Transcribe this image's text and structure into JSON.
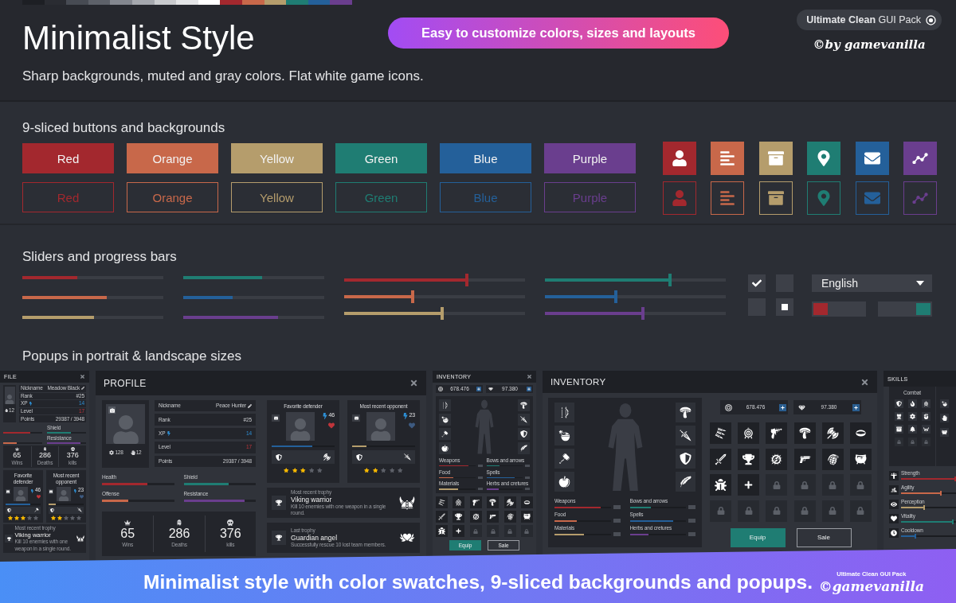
{
  "palette": [
    {
      "color": "#1d1f24"
    },
    {
      "color": "#2a2c32"
    },
    {
      "color": "#474b53"
    },
    {
      "color": "#5d6169"
    },
    {
      "color": "#83878f"
    },
    {
      "color": "#a5a8ae"
    },
    {
      "color": "#c9cbce"
    },
    {
      "color": "#e4e5e7"
    },
    {
      "color": "#ffffff"
    },
    {
      "color": "#a3282e"
    },
    {
      "color": "#c8684a"
    },
    {
      "color": "#b59d6c"
    },
    {
      "color": "#1f7d73"
    },
    {
      "color": "#24609a"
    },
    {
      "color": "#6a3e8e"
    }
  ],
  "header": {
    "title": "Minimalist Style",
    "tagline": "Easy to customize colors, sizes and layouts",
    "pack_badge": "**Ultimate Clean** GUI Pack",
    "credit": "©by game**vanilla**",
    "subtitle": "Sharp backgrounds, muted and gray colors. Flat white game icons."
  },
  "buttons_section": {
    "heading": "9-sliced buttons and backgrounds",
    "filled_buttons": [
      {
        "label": "Red",
        "color": "#a3282e"
      },
      {
        "label": "Orange",
        "color": "#c8684a"
      },
      {
        "label": "Yellow",
        "color": "#b59d6c"
      },
      {
        "label": "Green",
        "color": "#1f7d73"
      },
      {
        "label": "Blue",
        "color": "#24609a"
      },
      {
        "label": "Purple",
        "color": "#6a3e8e"
      }
    ],
    "outline_buttons": [
      {
        "label": "Red",
        "color": "#a3282e"
      },
      {
        "label": "Orange",
        "color": "#c8684a"
      },
      {
        "label": "Yellow",
        "color": "#b59d6c"
      },
      {
        "label": "Green",
        "color": "#1f7d73"
      },
      {
        "label": "Blue",
        "color": "#24609a"
      },
      {
        "label": "Purple",
        "color": "#6a3e8e"
      }
    ],
    "filled_tiles": [
      {
        "kind": "person",
        "color": "#a3282e"
      },
      {
        "kind": "bars",
        "color": "#c8684a"
      },
      {
        "kind": "box",
        "color": "#b59d6c"
      },
      {
        "kind": "pin",
        "color": "#1f7d73"
      },
      {
        "kind": "mail",
        "color": "#24609a"
      },
      {
        "kind": "chart",
        "color": "#6a3e8e"
      }
    ],
    "outline_tiles": [
      {
        "kind": "person",
        "color": "#a3282e"
      },
      {
        "kind": "bars",
        "color": "#c8684a"
      },
      {
        "kind": "box",
        "color": "#b59d6c"
      },
      {
        "kind": "pin",
        "color": "#1f7d73"
      },
      {
        "kind": "mail",
        "color": "#24609a"
      },
      {
        "kind": "chart",
        "color": "#6a3e8e"
      }
    ]
  },
  "sliders_section": {
    "heading": "Sliders and progress bars",
    "progress_columns": [
      {
        "bars": [
          {
            "color": "#a3282e",
            "level": 0.39
          },
          {
            "color": "#c8684a",
            "level": 0.6
          },
          {
            "color": "#b59d6c",
            "level": 0.51
          }
        ]
      },
      {
        "bars": [
          {
            "color": "#1f7d73",
            "level": 0.56
          },
          {
            "color": "#24609a",
            "level": 0.35
          },
          {
            "color": "#6a3e8e",
            "level": 0.67
          }
        ]
      }
    ],
    "slider_columns": [
      {
        "sliders": [
          {
            "color": "#a3282e",
            "level": 0.68
          },
          {
            "color": "#c8684a",
            "level": 0.38
          },
          {
            "color": "#b59d6c",
            "level": 0.54
          }
        ]
      },
      {
        "sliders": [
          {
            "color": "#1f7d73",
            "level": 0.69
          },
          {
            "color": "#24609a",
            "level": 0.39
          },
          {
            "color": "#6a3e8e",
            "level": 0.54
          }
        ]
      }
    ],
    "tick_checkboxes": [
      {
        "checked": true
      },
      {
        "checked": false
      }
    ],
    "square_checkboxes": [
      {
        "checked": false
      },
      {
        "checked": true
      }
    ],
    "dropdown": {
      "value": "English"
    },
    "toggles": [
      {
        "on": false
      },
      {
        "on": true
      }
    ]
  },
  "popups_section": {
    "heading": "Popups in portrait & landscape sizes",
    "profile_portrait": {
      "title": "FILE",
      "avatar_stats": [
        {
          "kind": "hand",
          "value": "12"
        }
      ],
      "fields": [
        {
          "kind": "edit",
          "label": "Nickname",
          "value": "Meadow Black"
        },
        {
          "kind": "plain",
          "label": "Rank",
          "value": "#25"
        },
        {
          "kind": "xp",
          "label": "XP",
          "value": "14"
        },
        {
          "kind": "level",
          "label": "Level",
          "value": "17"
        },
        {
          "kind": "plain",
          "label": "Points",
          "value": "29387 / 3948"
        }
      ],
      "bars": [
        {
          "color": "#a3282e",
          "level": 0.7
        },
        {
          "label": "Shield",
          "color": "#1f7d73",
          "level": 0.62
        },
        {
          "color": "#c8684a",
          "level": 0.35
        },
        {
          "label": "Resistance",
          "color": "#6a3e8e",
          "level": 0.85
        }
      ],
      "stats": [
        {
          "kind": "crown",
          "value": "65",
          "label": "Wins"
        },
        {
          "kind": "tomb",
          "value": "286",
          "label": "Deaths"
        },
        {
          "kind": "skull",
          "value": "376",
          "label": "kills"
        }
      ],
      "cards": [
        {
          "title": "Favorite defender",
          "power": "46",
          "favorite": true,
          "color": "#24609a",
          "level": 0.7,
          "kind": "hammer",
          "stars": 3
        },
        {
          "title": "Most recent opponent",
          "power": "23",
          "favorite": false,
          "color": "#b59d6c",
          "level": 0.2,
          "kind": "dagger",
          "stars": 2
        }
      ],
      "trophies": [
        {
          "kind": "viking",
          "caption": "Most recent trophy",
          "name": "Viking warrior",
          "description": "Kill 10 enemies with one weapon in a single round."
        }
      ]
    },
    "profile_landscape": {
      "title": "PROFILE",
      "avatar_stats": [
        {
          "kind": "gear",
          "value": "128"
        },
        {
          "kind": "hand",
          "value": "12"
        }
      ],
      "fields": [
        {
          "kind": "edit",
          "label": "Nickname",
          "value": "Peace Hunter"
        },
        {
          "kind": "plain",
          "label": "Rank",
          "value": "#25"
        },
        {
          "kind": "xp",
          "label": "XP",
          "value": "14"
        },
        {
          "kind": "level",
          "label": "Level",
          "value": "17"
        },
        {
          "kind": "plain",
          "label": "Points",
          "value": "29387 / 3948"
        }
      ],
      "bars": [
        {
          "label": "Health",
          "color": "#a3282e",
          "level": 0.63
        },
        {
          "label": "Shield",
          "color": "#1f7d73",
          "level": 0.62
        },
        {
          "label": "Offense",
          "color": "#c8684a",
          "level": 0.37
        },
        {
          "label": "Resistance",
          "color": "#6a3e8e",
          "level": 0.85
        }
      ],
      "stats": [
        {
          "kind": "crown",
          "value": "65",
          "label": "Wins"
        },
        {
          "kind": "tomb",
          "value": "286",
          "label": "Deaths"
        },
        {
          "kind": "skull",
          "value": "376",
          "label": "kills"
        }
      ],
      "cards": [
        {
          "title": "Favorite defender",
          "power": "46",
          "favorite": true,
          "color": "#24609a",
          "level": 0.65,
          "kind": "axe",
          "stars": 3
        },
        {
          "title": "Most recent opponent",
          "power": "23",
          "favorite": false,
          "color": "#b59d6c",
          "level": 0.23,
          "kind": "dagger",
          "stars": 2
        }
      ],
      "trophies": [
        {
          "kind": "viking",
          "caption": "Most recent trophy",
          "name": "Viking warrior",
          "description": "Kill 10 enemies with one weapon in a single round."
        },
        {
          "kind": "angel",
          "caption": "Last trophy",
          "name": "Guardian angel",
          "description": "Successfully rescue 10 lost team members."
        }
      ]
    },
    "inventory_portrait": {
      "title": "INVENTORY",
      "currencies": [
        {
          "kind": "coin",
          "value": "678.476"
        },
        {
          "kind": "gem",
          "value": "97.380"
        }
      ],
      "left_slots": [
        {
          "kind": "bow"
        },
        {
          "kind": "potion"
        },
        {
          "kind": "hammer"
        },
        {
          "kind": "apple"
        }
      ],
      "right_slots": [
        {
          "kind": "mushroom"
        },
        {
          "kind": "dagger"
        },
        {
          "kind": "shield"
        },
        {
          "kind": "feather"
        }
      ],
      "bars": [
        {
          "label": "Weapons",
          "color": "#a3282e",
          "level": 0.82
        },
        {
          "label": "Bows and arrows",
          "color": "#1f7d73",
          "level": 0.37
        },
        {
          "label": "Food",
          "color": "#c8684a",
          "level": 0.4
        },
        {
          "label": "Spells",
          "color": "#24609a",
          "level": 0.77
        },
        {
          "label": "Materials",
          "color": "#b59d6c",
          "level": 0.52
        },
        {
          "label": "Herbs and cretures",
          "color": "#6a3e8e",
          "level": 0.33
        }
      ],
      "items": [
        {
          "kind": "bullets"
        },
        {
          "kind": "target"
        },
        {
          "kind": "raygun"
        },
        {
          "kind": "mushroom"
        },
        {
          "kind": "axe"
        },
        {
          "kind": "ring"
        },
        {
          "kind": "sword"
        },
        {
          "kind": "trophy"
        },
        {
          "kind": "compass"
        },
        {
          "kind": "pistol"
        },
        {
          "kind": "grenade"
        },
        {
          "kind": "cauldron"
        },
        {
          "kind": "bug"
        },
        {
          "kind": "plus"
        },
        {
          "kind": "lock"
        },
        {
          "kind": "lock"
        },
        {
          "kind": "lock"
        },
        {
          "kind": "lock"
        }
      ],
      "buttons": [
        {
          "kind": "primary",
          "label": "Equip"
        },
        {
          "kind": "secondary",
          "label": "Sale"
        }
      ]
    },
    "inventory_landscape": {
      "title": "INVENTORY",
      "currencies": [
        {
          "kind": "coin",
          "value": "678.476"
        },
        {
          "kind": "gem",
          "value": "97.380"
        }
      ],
      "left_slots": [
        {
          "kind": "bow"
        },
        {
          "kind": "potion"
        },
        {
          "kind": "hammer"
        },
        {
          "kind": "apple"
        }
      ],
      "right_slots": [
        {
          "kind": "mushroom"
        },
        {
          "kind": "dagger"
        },
        {
          "kind": "shield"
        },
        {
          "kind": "feather"
        }
      ],
      "bars": [
        {
          "label": "Weapons",
          "color": "#a3282e",
          "level": 0.82
        },
        {
          "label": "Bows and arrows",
          "color": "#1f7d73",
          "level": 0.37
        },
        {
          "label": "Food",
          "color": "#c8684a",
          "level": 0.4
        },
        {
          "label": "Spells",
          "color": "#24609a",
          "level": 0.77
        },
        {
          "label": "Materials",
          "color": "#b59d6c",
          "level": 0.52
        },
        {
          "label": "Herbs and cretures",
          "color": "#6a3e8e",
          "level": 0.33
        }
      ],
      "items": [
        {
          "kind": "bullets"
        },
        {
          "kind": "target"
        },
        {
          "kind": "raygun"
        },
        {
          "kind": "mushroom"
        },
        {
          "kind": "axe"
        },
        {
          "kind": "ring"
        },
        {
          "kind": "sword"
        },
        {
          "kind": "trophy"
        },
        {
          "kind": "compass"
        },
        {
          "kind": "pistol"
        },
        {
          "kind": "grenade"
        },
        {
          "kind": "cauldron"
        },
        {
          "kind": "bug"
        },
        {
          "kind": "plus"
        },
        {
          "kind": "lock"
        },
        {
          "kind": "lock"
        },
        {
          "kind": "lock"
        },
        {
          "kind": "lock"
        },
        {
          "kind": "lock"
        },
        {
          "kind": "lock"
        },
        {
          "kind": "lock"
        },
        {
          "kind": "lock"
        },
        {
          "kind": "lock"
        },
        {
          "kind": "lock"
        }
      ],
      "buttons": [
        {
          "kind": "primary",
          "label": "Equip"
        },
        {
          "kind": "secondary",
          "label": "Sale"
        }
      ]
    },
    "skills": {
      "title": "SKILLS",
      "category": "Combat",
      "combat_skills": [
        {
          "kind": "shield"
        },
        {
          "kind": "fire"
        },
        {
          "kind": "target"
        },
        {
          "kind": "tower"
        },
        {
          "kind": "cog"
        },
        {
          "kind": "fist"
        },
        {
          "kind": "box"
        },
        {
          "kind": "bell"
        },
        {
          "kind": "viking"
        },
        {
          "kind": "lock"
        },
        {
          "kind": "lock"
        },
        {
          "kind": "lock"
        }
      ],
      "other_skills": [
        {
          "kind": "potion"
        },
        {
          "kind": "hand"
        },
        {
          "kind": "cauldron"
        }
      ],
      "stats": [
        {
          "kind": "strength",
          "label": "Strength",
          "color": "#a3282e",
          "level": 1
        },
        {
          "kind": "agility",
          "label": "Agility",
          "color": "#c8684a",
          "level": 0.74
        },
        {
          "kind": "perception",
          "label": "Perception",
          "color": "#b59d6c",
          "level": 0.43
        },
        {
          "kind": "vitality",
          "label": "Vitality",
          "color": "#1f7d73",
          "level": 0.96
        },
        {
          "kind": "cooldown",
          "label": "Cooldown",
          "color": "#24609a",
          "level": 0.27
        }
      ]
    }
  },
  "banner": {
    "text": "Minimalist style with color swatches, 9-sliced backgrounds and popups.",
    "logo_caption": "Ultimate Clean GUI Pack",
    "logo_wordmark": "©gamevanilla"
  }
}
